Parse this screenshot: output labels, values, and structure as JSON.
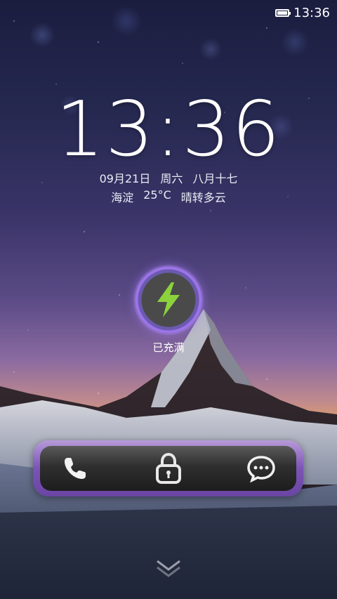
{
  "status_bar": {
    "time": "13:36",
    "battery_icon": "battery-full-icon"
  },
  "clock": {
    "time": "13:36"
  },
  "date": {
    "date": "09月21日",
    "weekday": "周六",
    "lunar": "八月十七"
  },
  "weather": {
    "location": "海淀",
    "temperature": "25°C",
    "condition": "晴转多云"
  },
  "charging": {
    "icon": "lightning-bolt-icon",
    "label": "已充满"
  },
  "dock": {
    "left_icon": "phone-icon",
    "center_icon": "lock-icon",
    "right_icon": "message-bubble-icon"
  },
  "swipe_hint_icon": "chevron-down-icon",
  "colors": {
    "ring_accent": "#9c74e8",
    "bolt_green": "#8bd23c"
  }
}
